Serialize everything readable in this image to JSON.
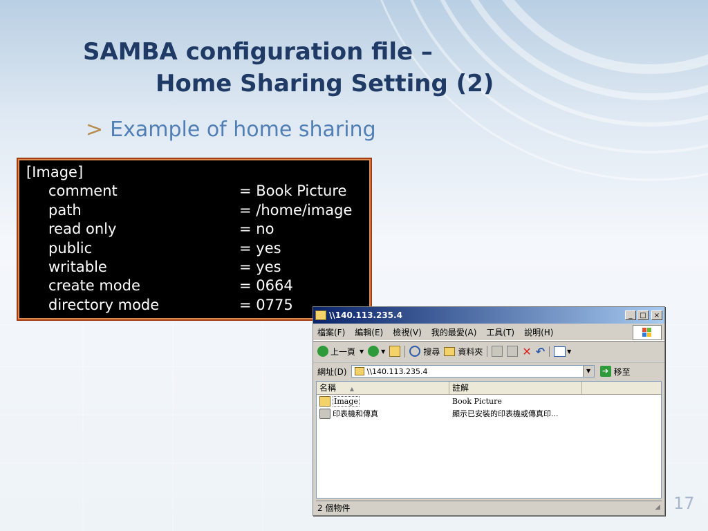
{
  "slide": {
    "title_line1": "SAMBA configuration file –",
    "title_line2": "Home Sharing Setting (2)",
    "bullet_marker": ">",
    "bullet": "Example of home sharing",
    "page_number": "17"
  },
  "code": {
    "section": "[Image]",
    "rows": [
      {
        "key": "comment",
        "value": "= Book Picture"
      },
      {
        "key": "path",
        "value": "= /home/image"
      },
      {
        "key": "read only",
        "value": "= no"
      },
      {
        "key": "public",
        "value": "= yes"
      },
      {
        "key": "writable",
        "value": "= yes"
      },
      {
        "key": "create mode",
        "value": "= 0664"
      },
      {
        "key": "directory mode",
        "value": "= 0775"
      }
    ]
  },
  "window": {
    "title": "\\\\140.113.235.4",
    "controls": {
      "minimize": "_",
      "maximize": "□",
      "close": "×"
    },
    "menu": [
      "檔案(F)",
      "編輯(E)",
      "檢視(V)",
      "我的最愛(A)",
      "工具(T)",
      "說明(H)"
    ],
    "toolbar": {
      "back": "上一頁",
      "search": "搜尋",
      "folders": "資料夾"
    },
    "address": {
      "label": "網址(D)",
      "value": "\\\\140.113.235.4",
      "go": "移至"
    },
    "columns": [
      "名稱",
      "註解"
    ],
    "items": [
      {
        "name": "Image",
        "comment": "Book Picture"
      },
      {
        "name": "印表機和傳真",
        "comment": "顯示已安裝的印表機或傳真印..."
      }
    ],
    "status": "2 個物件"
  },
  "colors": {
    "title": "#1f3a64",
    "bullet": "#4f7fb4",
    "bullet_marker": "#b68d52",
    "code_bg": "#000000",
    "code_border": "#a23c14",
    "titlebar": "#0a246a"
  }
}
